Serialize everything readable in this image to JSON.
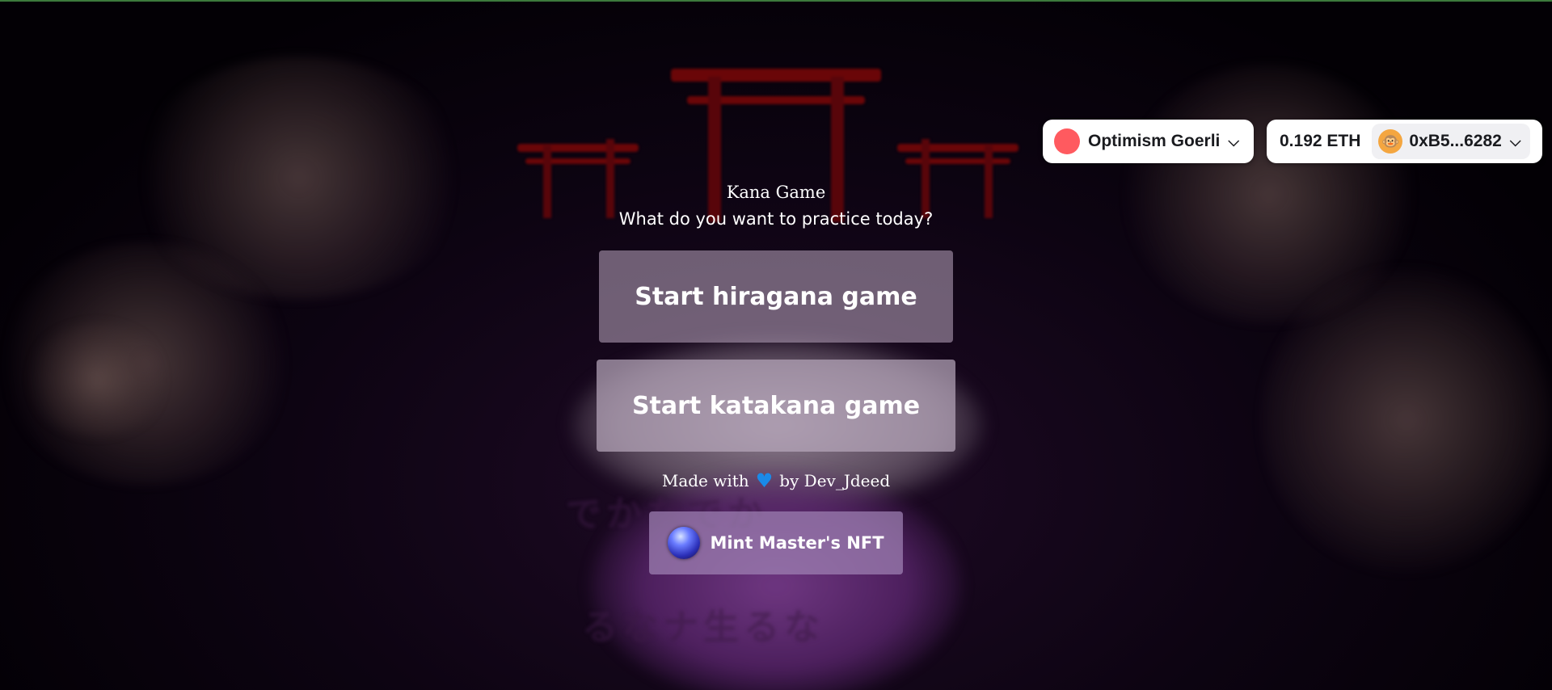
{
  "wallet": {
    "network_label": "Optimism Goerli",
    "network_color": "#ff5a5f",
    "balance": "0.192 ETH",
    "address": "0xB5...6282",
    "avatar_icon": "monkey-icon",
    "chevron_icon": "chevron-down-icon"
  },
  "main": {
    "title": "Kana Game",
    "subtitle": "What do you want to practice today?",
    "hiragana_button": "Start hiragana game",
    "katakana_button": "Start katakana game",
    "credit_prefix": "Made with",
    "credit_suffix": "by Dev_Jdeed",
    "heart_icon": "blue-heart-icon",
    "mint_button": "Mint Master's NFT"
  },
  "colors": {
    "accent_heart": "#1a8ae8",
    "torii_red": "#6a0608"
  }
}
